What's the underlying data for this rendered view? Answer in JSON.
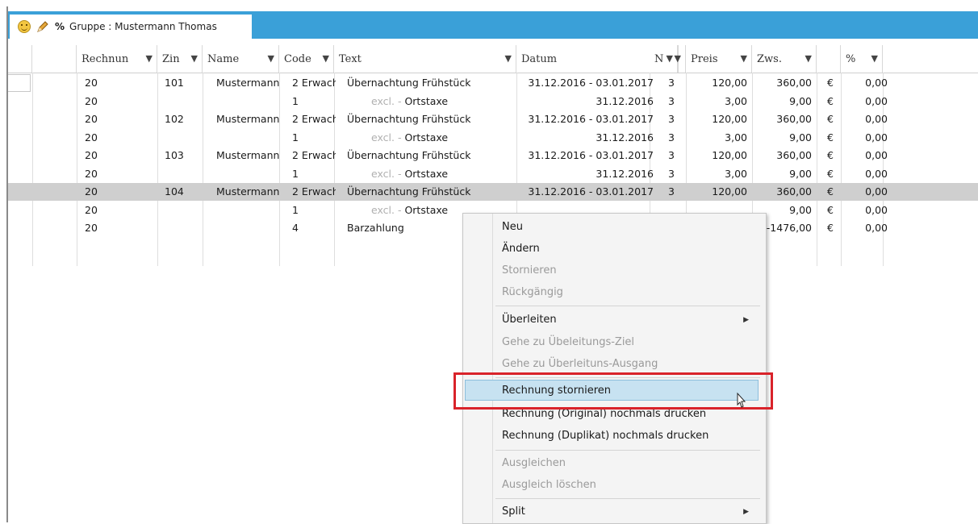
{
  "tab": {
    "pct": "%",
    "title": "Gruppe : Mustermann Thomas"
  },
  "columns": [
    "Rechnun",
    "Zin",
    "Name",
    "Code",
    "Text",
    "Datum",
    "N",
    "Preis",
    "Zws.",
    "",
    "%"
  ],
  "rows": [
    {
      "rechnung": "20",
      "zimmer": "101",
      "name": "Mustermann",
      "code": "2 Erwach",
      "excl": "",
      "text": "Übernachtung Frühstück",
      "datum": "31.12.2016 - 03.01.2017",
      "n": "3",
      "preis": "120,00",
      "zws": "360,00",
      "cur": "€",
      "pct": "0,00"
    },
    {
      "rechnung": "20",
      "zimmer": "",
      "name": "",
      "code": "1",
      "excl": "excl.  -",
      "text": "Ortstaxe",
      "datum": "31.12.2016",
      "n": "3",
      "preis": "3,00",
      "zws": "9,00",
      "cur": "€",
      "pct": "0,00"
    },
    {
      "rechnung": "20",
      "zimmer": "102",
      "name": "Mustermann",
      "code": "2 Erwach",
      "excl": "",
      "text": "Übernachtung Frühstück",
      "datum": "31.12.2016 - 03.01.2017",
      "n": "3",
      "preis": "120,00",
      "zws": "360,00",
      "cur": "€",
      "pct": "0,00"
    },
    {
      "rechnung": "20",
      "zimmer": "",
      "name": "",
      "code": "1",
      "excl": "excl.  -",
      "text": "Ortstaxe",
      "datum": "31.12.2016",
      "n": "3",
      "preis": "3,00",
      "zws": "9,00",
      "cur": "€",
      "pct": "0,00"
    },
    {
      "rechnung": "20",
      "zimmer": "103",
      "name": "Mustermann",
      "code": "2 Erwach",
      "excl": "",
      "text": "Übernachtung Frühstück",
      "datum": "31.12.2016 - 03.01.2017",
      "n": "3",
      "preis": "120,00",
      "zws": "360,00",
      "cur": "€",
      "pct": "0,00"
    },
    {
      "rechnung": "20",
      "zimmer": "",
      "name": "",
      "code": "1",
      "excl": "excl.  -",
      "text": "Ortstaxe",
      "datum": "31.12.2016",
      "n": "3",
      "preis": "3,00",
      "zws": "9,00",
      "cur": "€",
      "pct": "0,00"
    },
    {
      "rechnung": "20",
      "zimmer": "104",
      "name": "Mustermann",
      "code": "2 Erwach",
      "excl": "",
      "text": "Übernachtung Frühstück",
      "datum": "31.12.2016 - 03.01.2017",
      "n": "3",
      "preis": "120,00",
      "zws": "360,00",
      "cur": "€",
      "pct": "0,00"
    },
    {
      "rechnung": "20",
      "zimmer": "",
      "name": "",
      "code": "1",
      "excl": "excl.  -",
      "text": "Ortstaxe",
      "datum": "",
      "n": "",
      "preis": "",
      "zws": "9,00",
      "cur": "€",
      "pct": "0,00"
    },
    {
      "rechnung": "20",
      "zimmer": "",
      "name": "",
      "code": "4",
      "excl": "",
      "text": "Barzahlung",
      "datum": "",
      "n": "",
      "preis": "",
      "zws": "-1476,00",
      "cur": "€",
      "pct": "0,00"
    }
  ],
  "context_menu": {
    "neu": "Neu",
    "aendern": "Ändern",
    "stornieren": "Stornieren",
    "rueckgaengig": "Rückgängig",
    "ueberleiten": "Überleiten",
    "gehe_ziel": "Gehe zu Übeleitungs-Ziel",
    "gehe_ausgang": "Gehe zu Überleituns-Ausgang",
    "rechnung_stornieren": "Rechnung stornieren",
    "rechnung_original": "Rechnung (Original) nochmals drucken",
    "rechnung_duplikat": "Rechnung (Duplikat) nochmals drucken",
    "ausgleichen": "Ausgleichen",
    "ausgleich_loeschen": "Ausgleich löschen",
    "split": "Split"
  },
  "colors": {
    "accent": "#3aa0d8",
    "highlight": "#c7e2f1",
    "callout": "#d9232a",
    "selected_row": "#cfcfcf"
  }
}
